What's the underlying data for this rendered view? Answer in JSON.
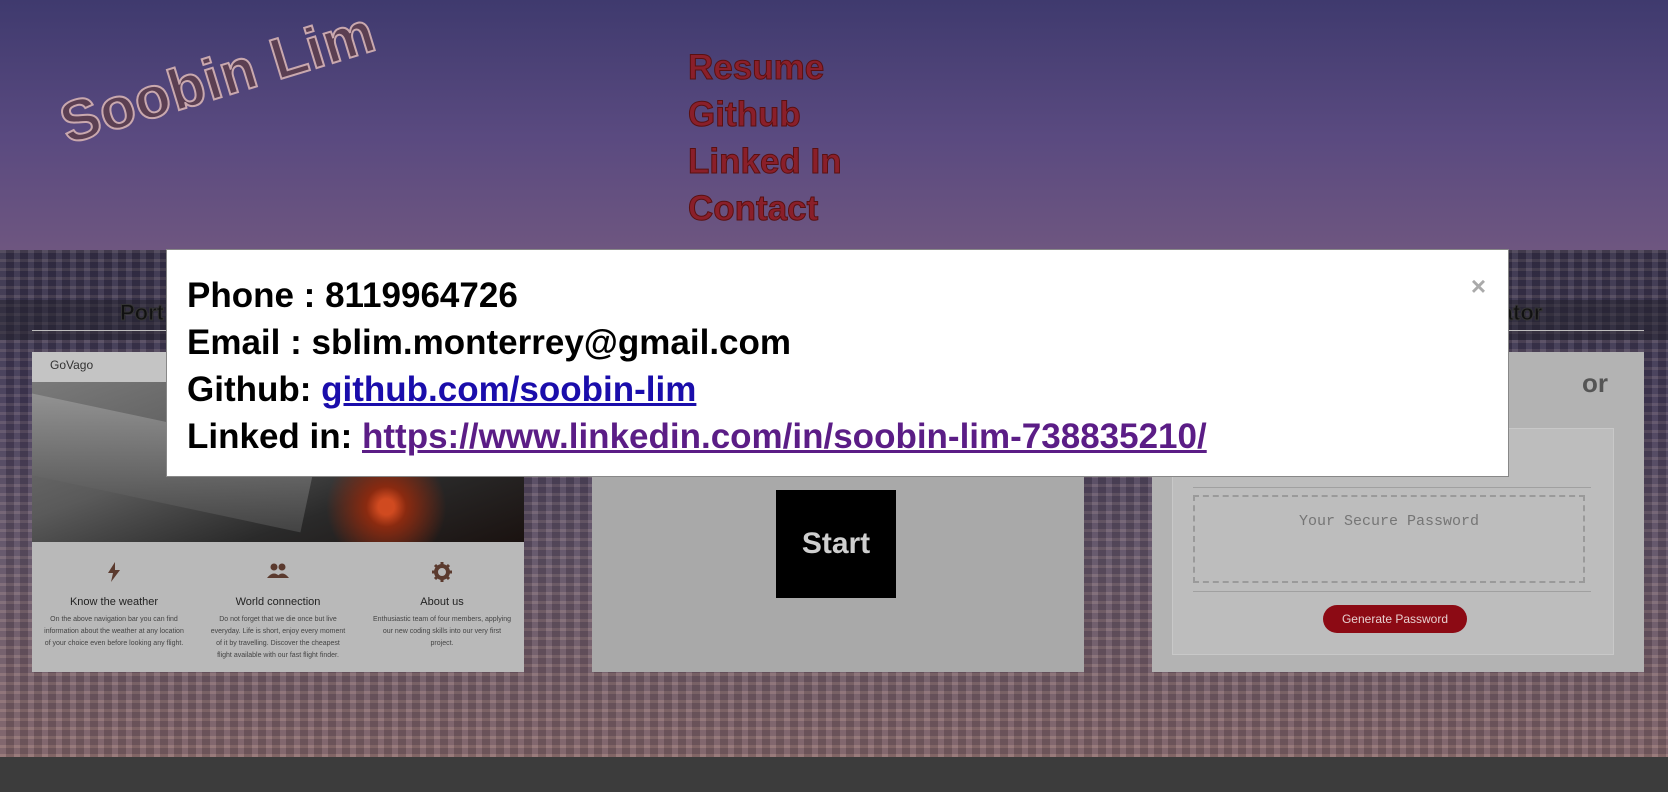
{
  "header": {
    "logo_text": "Soobin Lim",
    "nav": [
      {
        "label": "Resume"
      },
      {
        "label": "Github"
      },
      {
        "label": "Linked In"
      },
      {
        "label": "Contact"
      }
    ]
  },
  "portfolio": {
    "heading_left_partial": "Port",
    "heading_right_partial": "erator",
    "cards": [
      {
        "nav_brand": "GoVago",
        "features": [
          {
            "icon": "lightning-icon",
            "title": "Know the weather",
            "text": "On the above navigation bar you can find information about the weather at any location of your choice even before looking any flight."
          },
          {
            "icon": "people-icon",
            "title": "World connection",
            "text": "Do not forget that we die once but live everyday. Life is short, enjoy every moment of it by travelling. Discover the cheapest flight available with our fast flight finder."
          },
          {
            "icon": "gear-icon",
            "title": "About us",
            "text": "Enthusiastic team of four members, applying our new coding skills into our very first project."
          }
        ]
      },
      {
        "start_label": "Start"
      },
      {
        "title_partial": "or",
        "password_placeholder": "Your Secure Password",
        "generate_label": "Generate Password"
      }
    ]
  },
  "modal": {
    "close_symbol": "×",
    "phone_label": "Phone : ",
    "phone": "8119964726",
    "email_label": "Email : ",
    "email": "sblim.monterrey@gmail.com",
    "github_label": "Github: ",
    "github_link": "github.com/soobin-lim",
    "linkedin_label": "Linked in: ",
    "linkedin_link": "https://www.linkedin.com/in/soobin-lim-738835210/"
  },
  "colors": {
    "nav_link": "#8a1f2a",
    "github_link": "#1a0dab",
    "linkedin_link": "#5b1d86",
    "generate_button": "#8c0a14"
  }
}
